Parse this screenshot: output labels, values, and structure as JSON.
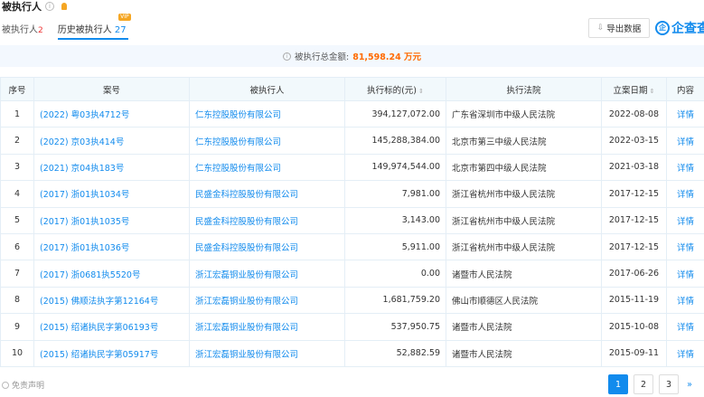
{
  "header": {
    "title": "被执行人",
    "info_icon": "info-icon",
    "bell_icon": "bell-icon"
  },
  "tabs": [
    {
      "label": "被执行人",
      "count": "2"
    },
    {
      "label": "历史被执行人",
      "count": "27",
      "badge": "VIP"
    }
  ],
  "toolbar": {
    "export_label": "导出数据"
  },
  "brand": {
    "logo_char": "企",
    "name": "企查查"
  },
  "summary": {
    "label": "被执行总金额:",
    "amount": "81,598.24 万元"
  },
  "table": {
    "headers": [
      "序号",
      "案号",
      "被执行人",
      "执行标的(元)",
      "执行法院",
      "立案日期",
      "内容"
    ],
    "rows": [
      [
        "1",
        "(2022) 粤03执4712号",
        "仁东控股股份有限公司",
        "394,127,072.00",
        "广东省深圳市中级人民法院",
        "2022-08-08",
        "详情"
      ],
      [
        "2",
        "(2022) 京03执414号",
        "仁东控股股份有限公司",
        "145,288,384.00",
        "北京市第三中级人民法院",
        "2022-03-15",
        "详情"
      ],
      [
        "3",
        "(2021) 京04执183号",
        "仁东控股股份有限公司",
        "149,974,544.00",
        "北京市第四中级人民法院",
        "2021-03-18",
        "详情"
      ],
      [
        "4",
        "(2017) 浙01执1034号",
        "民盛金科控股股份有限公司",
        "7,981.00",
        "浙江省杭州市中级人民法院",
        "2017-12-15",
        "详情"
      ],
      [
        "5",
        "(2017) 浙01执1035号",
        "民盛金科控股股份有限公司",
        "3,143.00",
        "浙江省杭州市中级人民法院",
        "2017-12-15",
        "详情"
      ],
      [
        "6",
        "(2017) 浙01执1036号",
        "民盛金科控股股份有限公司",
        "5,911.00",
        "浙江省杭州市中级人民法院",
        "2017-12-15",
        "详情"
      ],
      [
        "7",
        "(2017) 浙0681执5520号",
        "浙江宏磊铜业股份有限公司",
        "0.00",
        "诸暨市人民法院",
        "2017-06-26",
        "详情"
      ],
      [
        "8",
        "(2015) 佛顺法执字第12164号",
        "浙江宏磊铜业股份有限公司",
        "1,681,759.20",
        "佛山市顺德区人民法院",
        "2015-11-19",
        "详情"
      ],
      [
        "9",
        "(2015) 绍诸执民字第06193号",
        "浙江宏磊铜业股份有限公司",
        "537,950.75",
        "诸暨市人民法院",
        "2015-10-08",
        "详情"
      ],
      [
        "10",
        "(2015) 绍诸执民字第05917号",
        "浙江宏磊铜业股份有限公司",
        "52,882.59",
        "诸暨市人民法院",
        "2015-09-11",
        "详情"
      ]
    ]
  },
  "footer": {
    "disclaimer": "免责声明"
  },
  "pagination": {
    "pages": [
      "1",
      "2",
      "3"
    ],
    "current": "1",
    "next": "»"
  },
  "colors": {
    "accent": "#128bed",
    "amount": "#ff6a00",
    "header_bg": "#f2f9fc"
  }
}
